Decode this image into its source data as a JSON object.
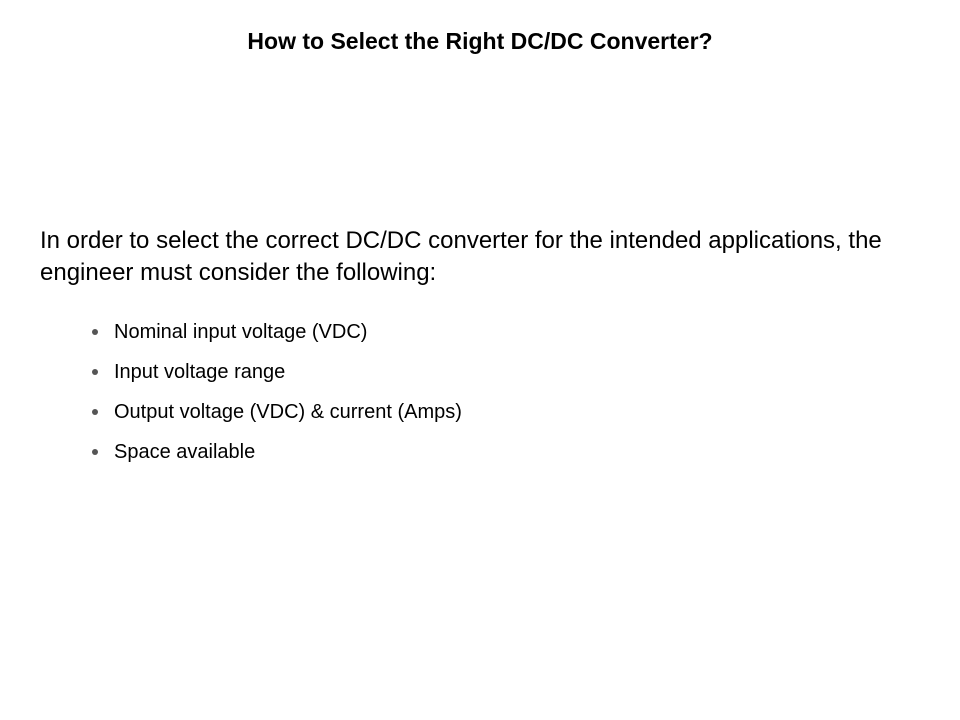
{
  "title": "How to Select the Right DC/DC Converter?",
  "intro": "In order to select the correct DC/DC converter for the intended applications, the engineer must consider the following:",
  "bullets": [
    "Nominal input voltage (VDC)",
    "Input voltage range",
    "Output voltage (VDC) & current (Amps)",
    "Space available"
  ]
}
